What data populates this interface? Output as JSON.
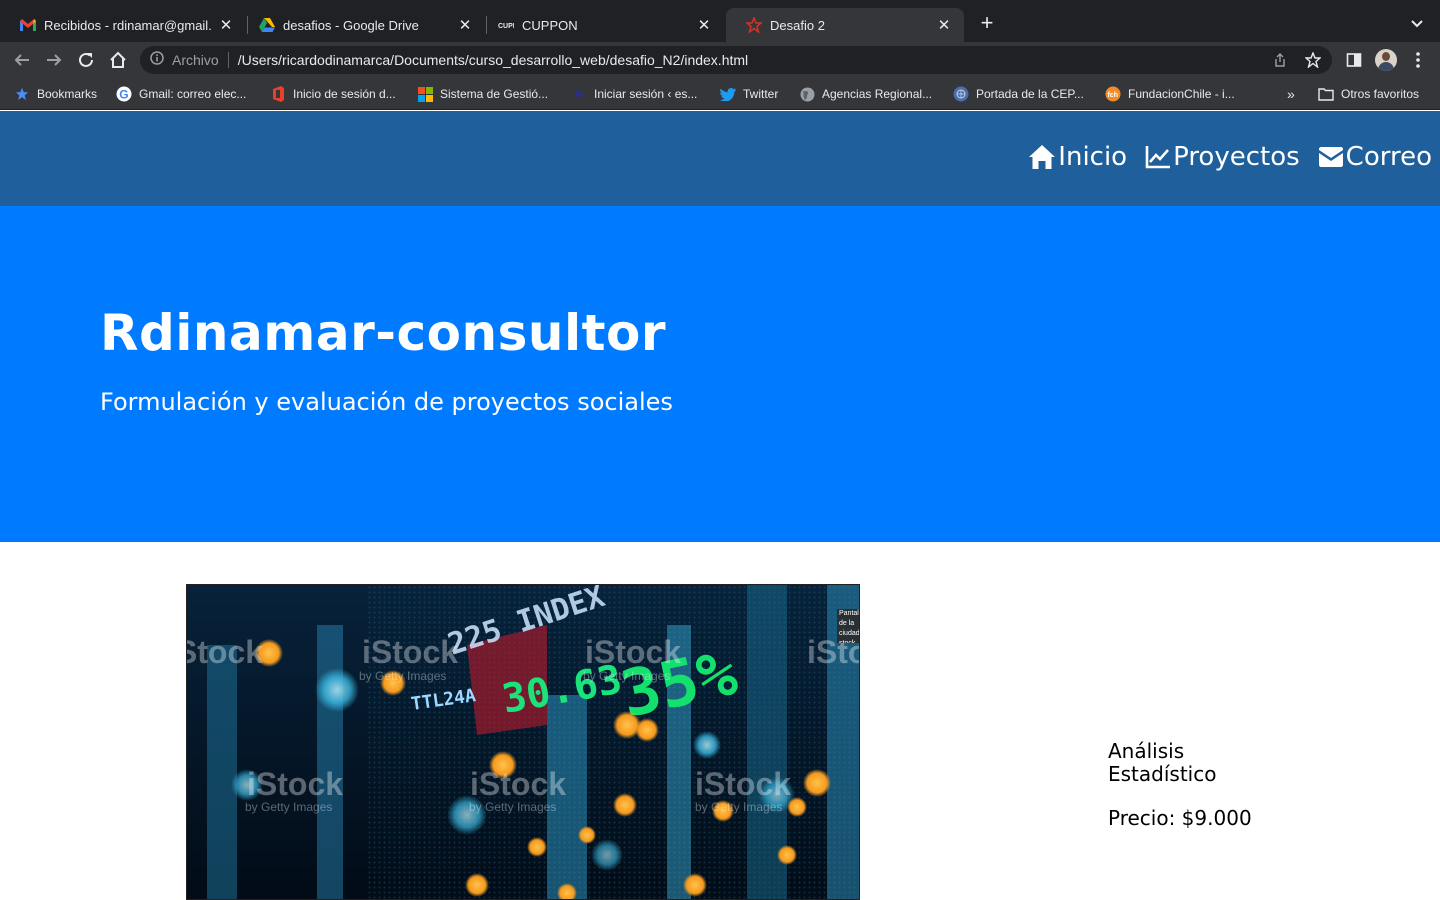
{
  "browser": {
    "tabs": [
      {
        "title": "Recibidos - rdinamar@gmail.com",
        "favicon": "gmail-icon",
        "active": false
      },
      {
        "title": "desafios - Google Drive",
        "favicon": "google-drive-icon",
        "active": false
      },
      {
        "title": "CUPPON",
        "favicon": "cuppon-icon",
        "active": false
      },
      {
        "title": "Desafio 2",
        "favicon": "page-icon",
        "active": true
      }
    ],
    "new_tab_label": "+",
    "address_bar": {
      "security_label": "Archivo",
      "url": "/Users/ricardodinamarca/Documents/curso_desarrollo_web/desafio_N2/index.html"
    },
    "bookmarks": [
      {
        "label": "Bookmarks",
        "icon": "star-icon"
      },
      {
        "label": "Gmail: correo elec...",
        "icon": "google-icon"
      },
      {
        "label": "Inicio de sesión d...",
        "icon": "office-icon"
      },
      {
        "label": "Sistema de Gestió...",
        "icon": "microsoft-icon"
      },
      {
        "label": "Iniciar sesión ‹ es...",
        "icon": "wordpress-icon"
      },
      {
        "label": "Twitter",
        "icon": "twitter-icon"
      },
      {
        "label": "Agencias Regional...",
        "icon": "globe-icon"
      },
      {
        "label": "Portada de la CEP...",
        "icon": "un-icon"
      },
      {
        "label": "FundacionChile - i...",
        "icon": "fundacion-icon"
      }
    ],
    "overflow_label": "»",
    "other_bookmarks_label": "Otros favoritos"
  },
  "page": {
    "nav": {
      "links": [
        {
          "label": "Inicio",
          "icon": "home-icon"
        },
        {
          "label": "Proyectos",
          "icon": "chart-line-icon"
        },
        {
          "label": "Correo",
          "icon": "envelope-icon"
        }
      ]
    },
    "hero": {
      "title": "Rdinamar-consultor",
      "subtitle": "Formulación y evaluación de proyectos sociales"
    },
    "product": {
      "image_alt": "Pantalla de la ciudad stock",
      "watermark": "iStock",
      "watermark_sub": "by Getty Images",
      "ticker_text": "225 INDEX",
      "ticker_value_1": "30.63",
      "ticker_value_2": "35%",
      "ticker_small": "TTL24A",
      "name": "Análisis Estadístico",
      "price": "Precio: $9.000"
    }
  },
  "colors": {
    "navbar": "#1f5f9b",
    "hero": "#007bff",
    "chrome_dark": "#202124",
    "chrome_toolbar": "#35363a"
  }
}
